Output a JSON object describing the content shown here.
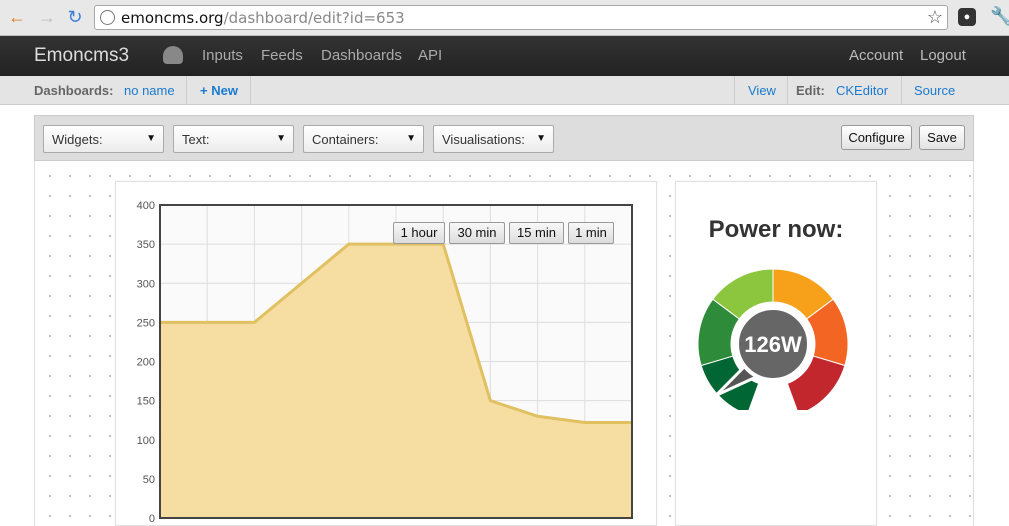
{
  "browser": {
    "url_host": "emoncms.org",
    "url_path": "/dashboard/edit?id=653"
  },
  "navbar": {
    "brand": "Emoncms3",
    "links": [
      "Inputs",
      "Feeds",
      "Dashboards",
      "API"
    ],
    "right_links": [
      "Account",
      "Logout"
    ]
  },
  "subbar": {
    "dashboards_label": "Dashboards:",
    "dashboard_name": "no name",
    "new_label": "+ New",
    "view_label": "View",
    "edit_label": "Edit:",
    "ckeditor_label": "CKEditor",
    "source_label": "Source"
  },
  "toolbar": {
    "selects": [
      "Widgets:",
      "Text:",
      "Containers:",
      "Visualisations:"
    ],
    "configure_label": "Configure",
    "save_label": "Save"
  },
  "power_widget": {
    "title": "Power now:",
    "value_label": "126W",
    "colors": {
      "needle_body": "#666666",
      "segments": [
        "#006633",
        "#2e8b3a",
        "#8cc63f",
        "#f7a11a",
        "#f26522",
        "#c1272d"
      ]
    }
  },
  "chart_controls": [
    "1 hour",
    "30 min",
    "15 min",
    "1 min"
  ],
  "chart_data": {
    "type": "area",
    "x_index": [
      0,
      1,
      2,
      3,
      4,
      5,
      6,
      7,
      8,
      9,
      10
    ],
    "values": [
      250,
      250,
      250,
      300,
      350,
      350,
      350,
      150,
      130,
      122,
      122
    ],
    "ylim": [
      0,
      400
    ],
    "y_ticks": [
      0,
      50,
      100,
      150,
      200,
      250,
      300,
      350,
      400
    ],
    "grid": true,
    "fill_color": "#f6dc9e",
    "line_color": "#e0c060"
  }
}
